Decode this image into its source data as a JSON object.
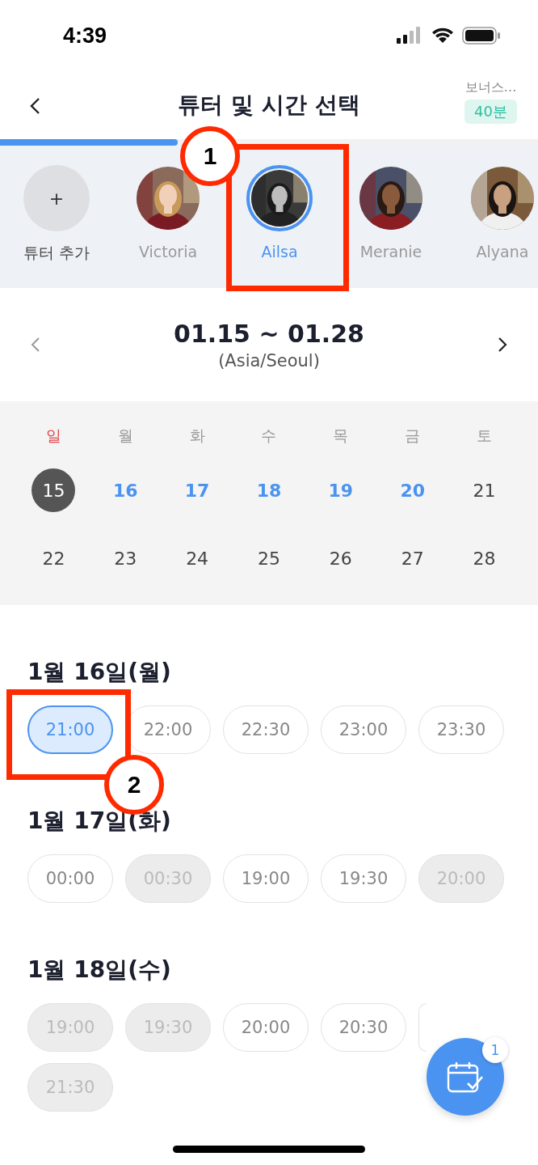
{
  "status_bar": {
    "time": "4:39"
  },
  "header": {
    "title": "튜터 및 시간 선택",
    "bonus_label": "보너스…",
    "bonus_value": "40분"
  },
  "progress": {
    "level": 0.33
  },
  "tutors": [
    {
      "name": "튜터 추가",
      "kind": "add",
      "icon_text": "+",
      "selected": false
    },
    {
      "name": "Victoria",
      "kind": "tutor",
      "selected": false
    },
    {
      "name": "Ailsa",
      "kind": "tutor",
      "selected": true
    },
    {
      "name": "Meranie",
      "kind": "tutor",
      "selected": false
    },
    {
      "name": "Alyana",
      "kind": "tutor",
      "selected": false
    }
  ],
  "date_nav": {
    "range": "01.15 ~ 01.28",
    "timezone": "(Asia/Seoul)"
  },
  "calendar": {
    "weekdays": [
      {
        "label": "일",
        "color": "#e0474c"
      },
      {
        "label": "월",
        "color": "#999999"
      },
      {
        "label": "화",
        "color": "#999999"
      },
      {
        "label": "수",
        "color": "#999999"
      },
      {
        "label": "목",
        "color": "#999999"
      },
      {
        "label": "금",
        "color": "#999999"
      },
      {
        "label": "토",
        "color": "#999999"
      }
    ],
    "days": [
      {
        "label": "15",
        "today": true,
        "available": false
      },
      {
        "label": "16",
        "today": false,
        "available": true
      },
      {
        "label": "17",
        "today": false,
        "available": true
      },
      {
        "label": "18",
        "today": false,
        "available": true
      },
      {
        "label": "19",
        "today": false,
        "available": true
      },
      {
        "label": "20",
        "today": false,
        "available": true
      },
      {
        "label": "21",
        "today": false,
        "available": false
      },
      {
        "label": "22",
        "today": false,
        "available": false
      },
      {
        "label": "23",
        "today": false,
        "available": false
      },
      {
        "label": "24",
        "today": false,
        "available": false
      },
      {
        "label": "25",
        "today": false,
        "available": false
      },
      {
        "label": "26",
        "today": false,
        "available": false
      },
      {
        "label": "27",
        "today": false,
        "available": false
      },
      {
        "label": "28",
        "today": false,
        "available": false
      }
    ]
  },
  "days": [
    {
      "heading": "1월 16일(월)",
      "slots": [
        {
          "time": "21:00",
          "selected": true,
          "disabled": false
        },
        {
          "time": "22:00",
          "selected": false,
          "disabled": false
        },
        {
          "time": "22:30",
          "selected": false,
          "disabled": false
        },
        {
          "time": "23:00",
          "selected": false,
          "disabled": false
        },
        {
          "time": "23:30",
          "selected": false,
          "disabled": false
        }
      ]
    },
    {
      "heading": "1월 17일(화)",
      "slots": [
        {
          "time": "00:00",
          "selected": false,
          "disabled": false
        },
        {
          "time": "00:30",
          "selected": false,
          "disabled": true
        },
        {
          "time": "19:00",
          "selected": false,
          "disabled": false
        },
        {
          "time": "19:30",
          "selected": false,
          "disabled": false
        },
        {
          "time": "20:00",
          "selected": false,
          "disabled": true
        }
      ]
    },
    {
      "heading": "1월 18일(수)",
      "slots": [
        {
          "time": "19:00",
          "selected": false,
          "disabled": true
        },
        {
          "time": "19:30",
          "selected": false,
          "disabled": true
        },
        {
          "time": "20:00",
          "selected": false,
          "disabled": false
        },
        {
          "time": "20:30",
          "selected": false,
          "disabled": false
        },
        {
          "kind": "covered",
          "selected": false,
          "disabled": false
        },
        {
          "time": "21:30",
          "selected": false,
          "disabled": true
        }
      ]
    }
  ],
  "fab": {
    "badge": "1"
  },
  "annotations": [
    {
      "label": "1"
    },
    {
      "label": "2"
    }
  ]
}
